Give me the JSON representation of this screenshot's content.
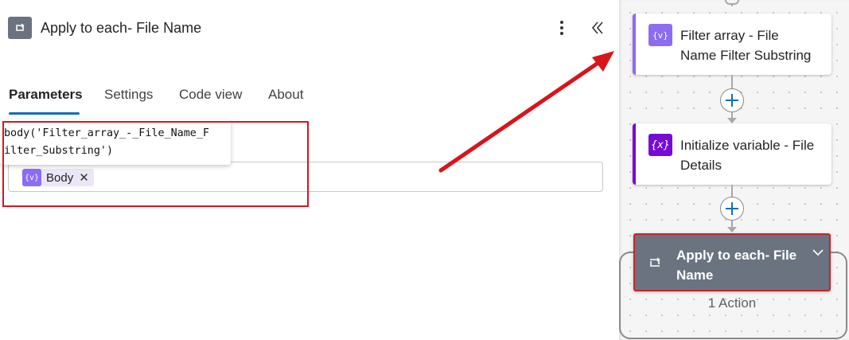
{
  "panel": {
    "title": "Apply to each- File Name",
    "more_icon": "more-vertical-icon",
    "collapse_icon": "double-chevron-left-icon"
  },
  "tabs": [
    {
      "label": "Parameters",
      "active": true
    },
    {
      "label": "Settings",
      "active": false
    },
    {
      "label": "Code view",
      "active": false
    },
    {
      "label": "About",
      "active": false
    }
  ],
  "expression_tooltip": "body('Filter_array_-_File_Name_F\nilter_Substring')",
  "input": {
    "token_icon_text": "{v}",
    "token_label": "Body",
    "token_remove": "✕"
  },
  "flow": {
    "cards": [
      {
        "title": "Filter array - File Name Filter Substring",
        "line1": "Filter array - File",
        "line2": "Name Filter Substring",
        "icon_text": "{v}",
        "accent": "#8c6cf0"
      },
      {
        "title": "Initialize variable - File Details",
        "line1": "Initialize variable - File",
        "line2": "Details",
        "icon_text": "{x}",
        "accent": "#770bd6"
      }
    ],
    "scope": {
      "line1": "Apply to each- File",
      "line2": "Name",
      "action_count": "1 Action"
    }
  },
  "colors": {
    "accent_blue": "#0f6cbd",
    "highlight_red": "#d9141b",
    "scope_gray": "#6b7380"
  }
}
